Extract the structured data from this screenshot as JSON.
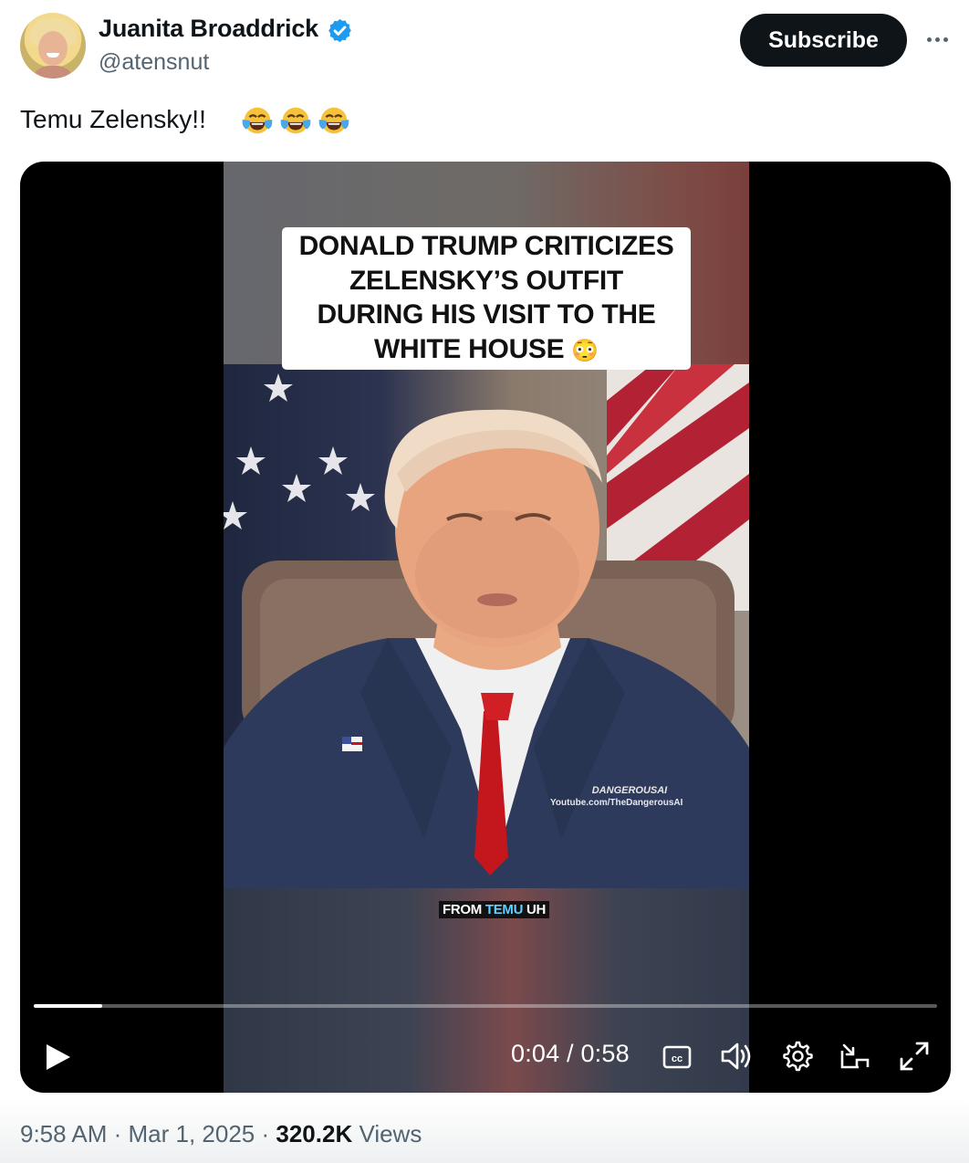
{
  "author": {
    "display_name": "Juanita Broaddrick",
    "handle": "@atensnut",
    "verified_color": "#1d9bf0"
  },
  "header": {
    "subscribe_label": "Subscribe",
    "more_icon": "more-horizontal-icon"
  },
  "tweet": {
    "text": "Temu Zelensky!!",
    "emojis": [
      "face-with-tears-of-joy",
      "face-with-tears-of-joy",
      "face-with-tears-of-joy"
    ]
  },
  "video": {
    "caption": "DONALD TRUMP CRITICIZES ZELENSKY’S OUTFIT DURING HIS VISIT TO THE WHITE HOUSE",
    "caption_emoji": "😳",
    "watermark_name": "DANGEROUSAI",
    "watermark_url": "Youtube.com/TheDangerousAI",
    "subtitle_pre": "FROM ",
    "subtitle_highlight": "TEMU",
    "subtitle_post": " UH",
    "current_time": "0:04",
    "separator": " / ",
    "duration": "0:58",
    "progress_fraction": 0.076,
    "controls": {
      "play": "play-icon",
      "captions": "closed-captions-icon",
      "volume": "volume-icon",
      "settings": "gear-icon",
      "pip": "picture-in-picture-icon",
      "fullscreen": "fullscreen-icon"
    }
  },
  "meta": {
    "time": "9:58 AM",
    "dot": " · ",
    "date": "Mar 1, 2025",
    "views_count": "320.2K",
    "views_label": " Views"
  }
}
